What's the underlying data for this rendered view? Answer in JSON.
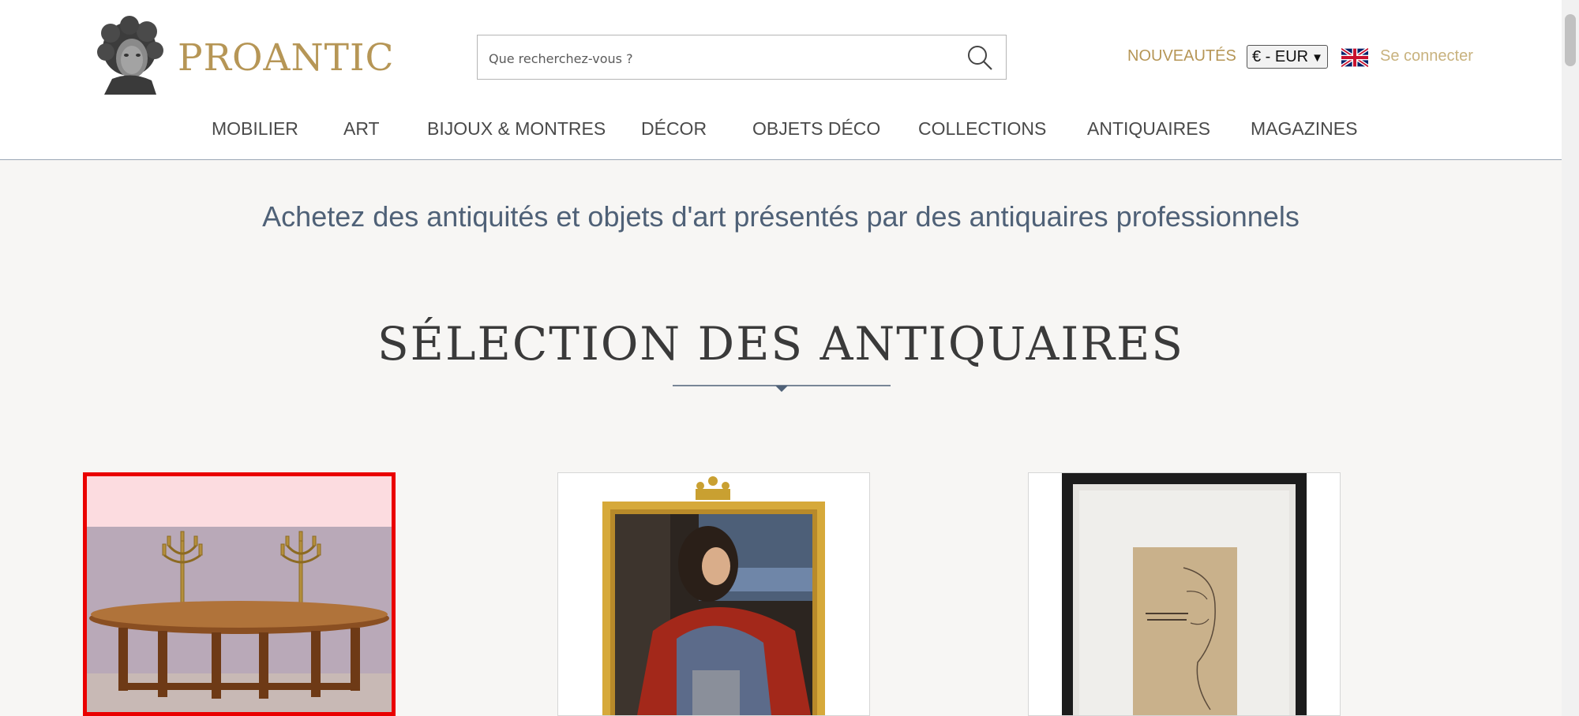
{
  "header": {
    "logo_text": "PROANTIC",
    "search": {
      "placeholder": "Que recherchez-vous ?",
      "value": ""
    },
    "nouveautes_label": "NOUVEAUTÉS",
    "currency": {
      "selected": "€ - EUR"
    },
    "language_flag": "uk-flag-icon",
    "login_label": "Se connecter"
  },
  "nav": {
    "items": [
      {
        "label": "MOBILIER"
      },
      {
        "label": "ART"
      },
      {
        "label": "BIJOUX & MONTRES"
      },
      {
        "label": "DÉCOR"
      },
      {
        "label": "OBJETS DÉCO"
      },
      {
        "label": "COLLECTIONS"
      },
      {
        "label": "ANTIQUAIRES"
      },
      {
        "label": "MAGAZINES"
      }
    ]
  },
  "main": {
    "tagline": "Achetez des antiquités et objets d'art présentés par des antiquaires professionnels",
    "section_title": "SÉLECTION DES ANTIQUAIRES",
    "cards": [
      {
        "subject": "table-with-candelabras",
        "selected": true
      },
      {
        "subject": "royal-portrait-painting",
        "selected": false
      },
      {
        "subject": "framed-sketch-drawing",
        "selected": false
      }
    ]
  },
  "colors": {
    "brand_gold": "#b69656",
    "nav_text": "#4a4a4a",
    "tagline_blue": "#4f6177",
    "selection_red": "#ea0000",
    "page_background": "#f7f6f4"
  }
}
